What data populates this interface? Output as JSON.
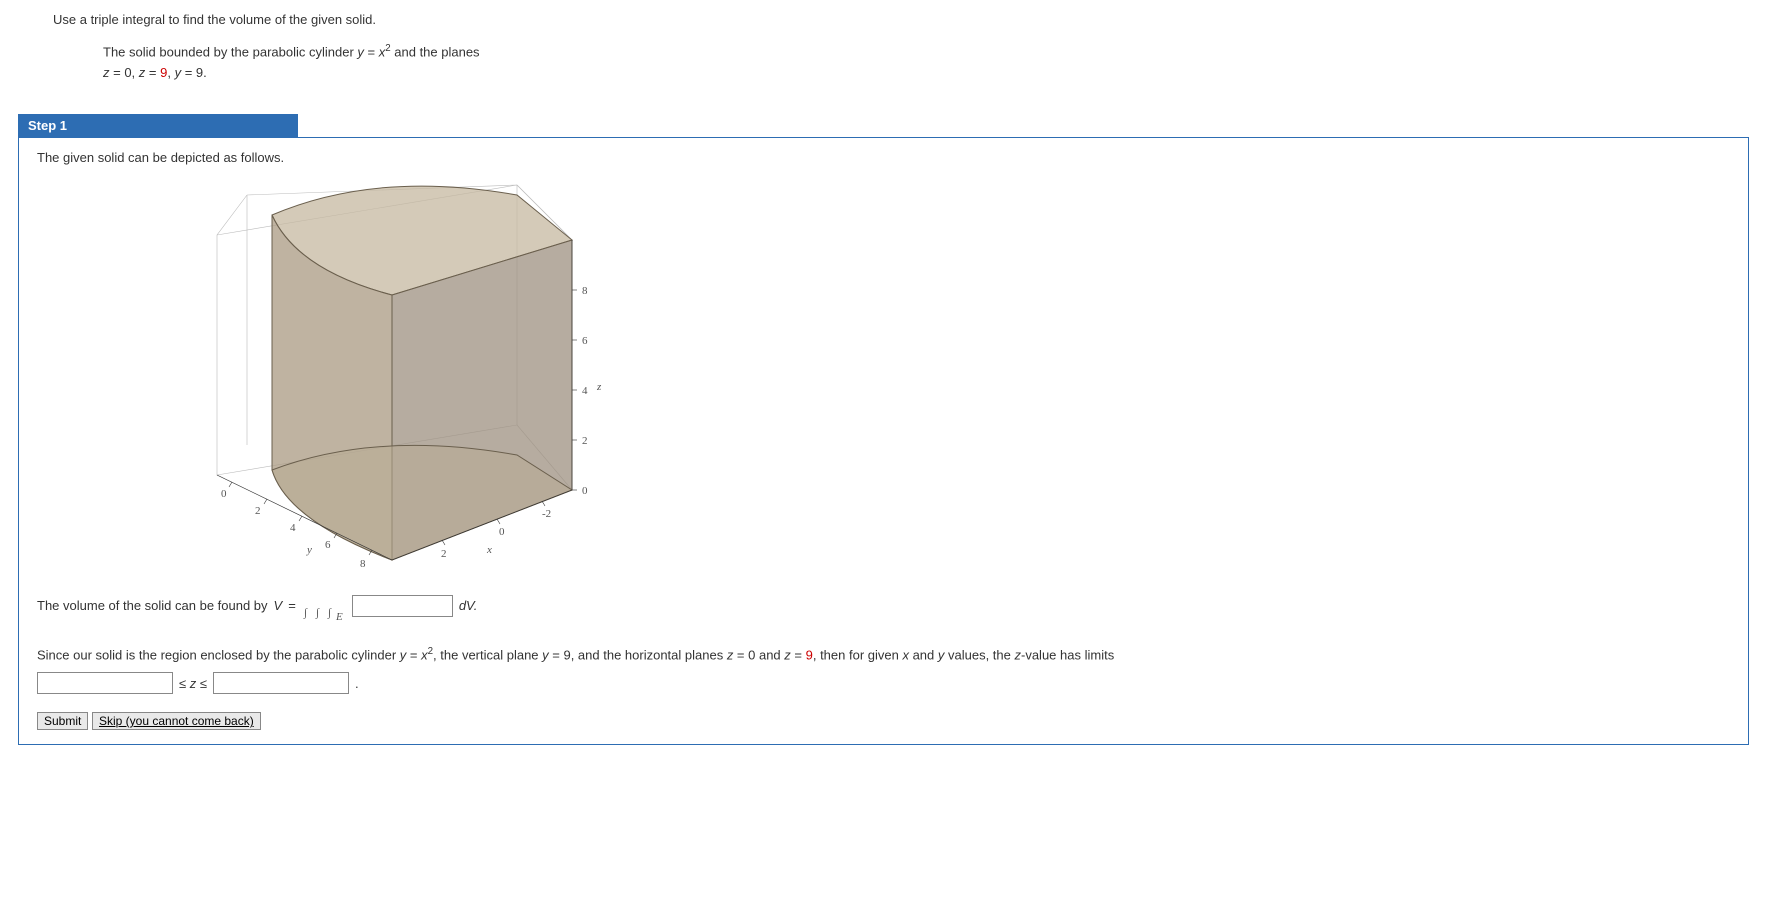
{
  "problem": {
    "instruction": "Use a triple integral to find the volume of the given solid.",
    "description_prefix": "The solid bounded by the parabolic cylinder ",
    "eq1_var": "y",
    "eq1_eq": " = ",
    "eq1_rhs": "x",
    "eq1_exp": "2",
    "description_mid": " and the planes",
    "plane1_var": "z",
    "plane1_rhs": " = 0, ",
    "plane2_var": "z",
    "plane2_rhs": " = ",
    "plane2_val": "9",
    "plane3_sep": ", ",
    "plane3_var": "y",
    "plane3_rhs": " = 9."
  },
  "step": {
    "label": "Step 1",
    "intro": "The given solid can be depicted as follows.",
    "volume_prefix": "The volume of the solid can be found by ",
    "V": "V",
    "equals": " = ",
    "dV": "dV.",
    "region_prefix": "Since our solid is the region enclosed by the parabolic cylinder ",
    "region_eq_y": "y",
    "region_eq_eq": " = ",
    "region_eq_x": "x",
    "region_eq_exp": "2",
    "region_mid1": ",  the vertical plane ",
    "region_y9_var": "y",
    "region_y9_rhs": " = 9, and the horizontal planes ",
    "region_z0_var": "z",
    "region_z0_rhs": " = 0 and ",
    "region_z9_var": "z",
    "region_z9_rhs": " = ",
    "region_z9_val": "9",
    "region_tail": ", then for given ",
    "region_x": "x",
    "region_and": " and ",
    "region_yvar": "y",
    "region_tail2": " values, the ",
    "region_zvar": "z",
    "region_tail3": "-value has limits",
    "leq_z_leq": " ≤ z ≤ ",
    "period": "."
  },
  "buttons": {
    "submit": "Submit",
    "skip": "Skip (you cannot come back)"
  },
  "graph": {
    "x_label": "x",
    "y_label": "y",
    "z_label": "z",
    "z_ticks": [
      "0",
      "2",
      "4",
      "6",
      "8"
    ],
    "x_ticks": [
      "-2",
      "0",
      "2"
    ],
    "y_ticks": [
      "0",
      "2",
      "4",
      "6",
      "8"
    ]
  },
  "chart_data": {
    "type": "surface",
    "description": "3D solid bounded by parabolic cylinder y = x^2, plane y = 9, z = 0 to z = 9",
    "x_range": [
      -3,
      3
    ],
    "y_range": [
      0,
      9
    ],
    "z_range": [
      0,
      9
    ],
    "bounding_surfaces": [
      {
        "name": "parabolic_cylinder",
        "equation": "y = x^2"
      },
      {
        "name": "plane_y",
        "equation": "y = 9"
      },
      {
        "name": "plane_z_bottom",
        "equation": "z = 0"
      },
      {
        "name": "plane_z_top",
        "equation": "z = 9"
      }
    ]
  }
}
